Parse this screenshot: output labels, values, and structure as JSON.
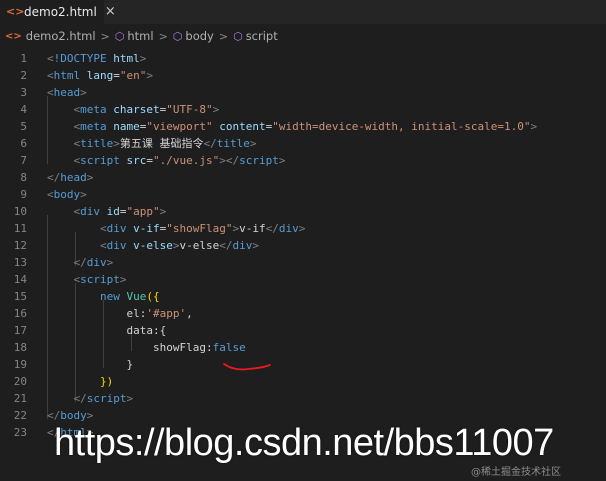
{
  "tab": {
    "label": "demo2.html",
    "icon": "html-file-icon",
    "close_glyph": "×"
  },
  "breadcrumb": {
    "items": [
      "demo2.html",
      "html",
      "body",
      "script"
    ]
  },
  "lines": [
    {
      "n": "1",
      "tokens": [
        [
          "punct",
          "<"
        ],
        [
          "tag",
          "!DOCTYPE"
        ],
        [
          "txt",
          " "
        ],
        [
          "attr",
          "html"
        ],
        [
          "punct",
          ">"
        ]
      ]
    },
    {
      "n": "2",
      "tokens": [
        [
          "punct",
          "<"
        ],
        [
          "tag",
          "html"
        ],
        [
          "txt",
          " "
        ],
        [
          "attr",
          "lang"
        ],
        [
          "txt",
          "="
        ],
        [
          "str",
          "\"en\""
        ],
        [
          "punct",
          ">"
        ]
      ]
    },
    {
      "n": "3",
      "tokens": [
        [
          "punct",
          "<"
        ],
        [
          "tag",
          "head"
        ],
        [
          "punct",
          ">"
        ]
      ]
    },
    {
      "n": "4",
      "tokens": [
        [
          "txt",
          "    "
        ],
        [
          "punct",
          "<"
        ],
        [
          "tag",
          "meta"
        ],
        [
          "txt",
          " "
        ],
        [
          "attr",
          "charset"
        ],
        [
          "txt",
          "="
        ],
        [
          "str",
          "\"UTF-8\""
        ],
        [
          "punct",
          ">"
        ]
      ]
    },
    {
      "n": "5",
      "tokens": [
        [
          "txt",
          "    "
        ],
        [
          "punct",
          "<"
        ],
        [
          "tag",
          "meta"
        ],
        [
          "txt",
          " "
        ],
        [
          "attr",
          "name"
        ],
        [
          "txt",
          "="
        ],
        [
          "str",
          "\"viewport\""
        ],
        [
          "txt",
          " "
        ],
        [
          "attr",
          "content"
        ],
        [
          "txt",
          "="
        ],
        [
          "str",
          "\"width=device-width, initial-scale=1.0\""
        ],
        [
          "punct",
          ">"
        ]
      ]
    },
    {
      "n": "6",
      "tokens": [
        [
          "txt",
          "    "
        ],
        [
          "punct",
          "<"
        ],
        [
          "tag",
          "title"
        ],
        [
          "punct",
          ">"
        ],
        [
          "txt",
          "第五课 基础指令"
        ],
        [
          "punct",
          "</"
        ],
        [
          "tag",
          "title"
        ],
        [
          "punct",
          ">"
        ]
      ]
    },
    {
      "n": "7",
      "tokens": [
        [
          "txt",
          "    "
        ],
        [
          "punct",
          "<"
        ],
        [
          "tag",
          "script"
        ],
        [
          "txt",
          " "
        ],
        [
          "attr",
          "src"
        ],
        [
          "txt",
          "="
        ],
        [
          "str",
          "\"./vue.js\""
        ],
        [
          "punct",
          "></"
        ],
        [
          "tag",
          "script"
        ],
        [
          "punct",
          ">"
        ]
      ]
    },
    {
      "n": "8",
      "tokens": [
        [
          "punct",
          "</"
        ],
        [
          "tag",
          "head"
        ],
        [
          "punct",
          ">"
        ]
      ]
    },
    {
      "n": "9",
      "tokens": [
        [
          "punct",
          "<"
        ],
        [
          "tag",
          "body"
        ],
        [
          "punct",
          ">"
        ]
      ]
    },
    {
      "n": "10",
      "tokens": [
        [
          "txt",
          "    "
        ],
        [
          "punct",
          "<"
        ],
        [
          "tag",
          "div"
        ],
        [
          "txt",
          " "
        ],
        [
          "attr",
          "id"
        ],
        [
          "txt",
          "="
        ],
        [
          "str",
          "\"app\""
        ],
        [
          "punct",
          ">"
        ]
      ]
    },
    {
      "n": "11",
      "tokens": [
        [
          "txt",
          "        "
        ],
        [
          "punct",
          "<"
        ],
        [
          "tag",
          "div"
        ],
        [
          "txt",
          " "
        ],
        [
          "attr",
          "v-if"
        ],
        [
          "txt",
          "="
        ],
        [
          "str",
          "\"showFlag\""
        ],
        [
          "punct",
          ">"
        ],
        [
          "txt",
          "v-if"
        ],
        [
          "punct",
          "</"
        ],
        [
          "tag",
          "div"
        ],
        [
          "punct",
          ">"
        ]
      ]
    },
    {
      "n": "12",
      "tokens": [
        [
          "txt",
          "        "
        ],
        [
          "punct",
          "<"
        ],
        [
          "tag",
          "div"
        ],
        [
          "txt",
          " "
        ],
        [
          "attr",
          "v-else"
        ],
        [
          "punct",
          ">"
        ],
        [
          "txt",
          "v-else"
        ],
        [
          "punct",
          "</"
        ],
        [
          "tag",
          "div"
        ],
        [
          "punct",
          ">"
        ]
      ]
    },
    {
      "n": "13",
      "tokens": [
        [
          "txt",
          "    "
        ],
        [
          "punct",
          "</"
        ],
        [
          "tag",
          "div"
        ],
        [
          "punct",
          ">"
        ]
      ]
    },
    {
      "n": "14",
      "tokens": [
        [
          "txt",
          "    "
        ],
        [
          "punct",
          "<"
        ],
        [
          "tag",
          "script"
        ],
        [
          "punct",
          ">"
        ]
      ]
    },
    {
      "n": "15",
      "tokens": [
        [
          "txt",
          "        "
        ],
        [
          "kw",
          "new"
        ],
        [
          "txt",
          " "
        ],
        [
          "cls",
          "Vue"
        ],
        [
          "bracket",
          "({"
        ]
      ]
    },
    {
      "n": "16",
      "tokens": [
        [
          "txt",
          "            "
        ],
        [
          "prop",
          "el:"
        ],
        [
          "str",
          "'#app'"
        ],
        [
          "txt",
          ","
        ]
      ]
    },
    {
      "n": "17",
      "tokens": [
        [
          "txt",
          "            "
        ],
        [
          "prop",
          "data:{"
        ]
      ]
    },
    {
      "n": "18",
      "tokens": [
        [
          "txt",
          "                "
        ],
        [
          "prop",
          "showFlag:"
        ],
        [
          "bool",
          "false"
        ]
      ]
    },
    {
      "n": "19",
      "tokens": [
        [
          "txt",
          "            "
        ],
        [
          "prop",
          "}"
        ]
      ]
    },
    {
      "n": "20",
      "tokens": [
        [
          "txt",
          "        "
        ],
        [
          "bracket",
          "})"
        ]
      ]
    },
    {
      "n": "21",
      "tokens": [
        [
          "txt",
          "    "
        ],
        [
          "punct",
          "</"
        ],
        [
          "tag",
          "script"
        ],
        [
          "punct",
          ">"
        ]
      ]
    },
    {
      "n": "22",
      "tokens": [
        [
          "punct",
          "</"
        ],
        [
          "tag",
          "body"
        ],
        [
          "punct",
          ">"
        ]
      ]
    },
    {
      "n": "23",
      "tokens": [
        [
          "punct",
          "</"
        ],
        [
          "tag",
          "html"
        ],
        [
          "punct",
          ">"
        ]
      ]
    }
  ],
  "watermark": "https://blog.csdn.net/bbs11007",
  "credit": "@稀土掘金技术社区",
  "annotation_color": "#e81b1b"
}
